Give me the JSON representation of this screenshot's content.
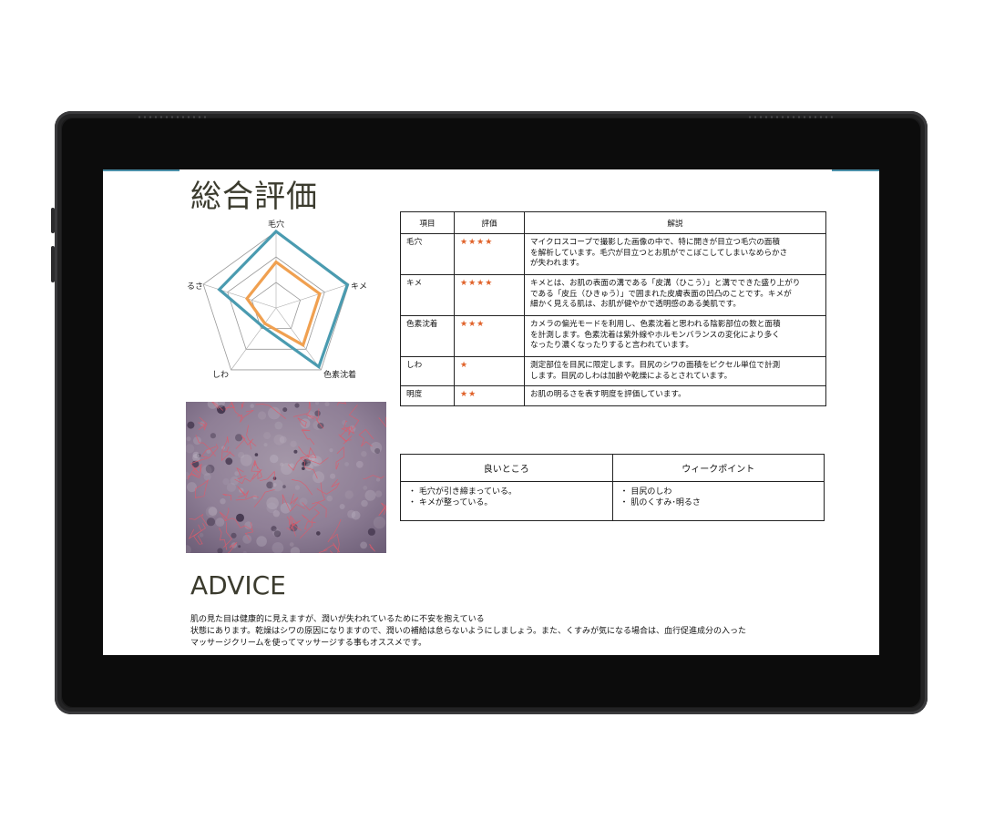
{
  "report": {
    "title": "総合評価",
    "radar": {
      "labels": [
        "毛穴",
        "キメ",
        "色素沈着",
        "しわ",
        "るさ"
      ],
      "levels": 3,
      "series": [
        {
          "color": "#4a9bb0",
          "values": [
            1.0,
            0.98,
            0.95,
            0.3,
            0.78
          ]
        },
        {
          "color": "#f0a050",
          "values": [
            0.6,
            0.6,
            0.6,
            0.25,
            0.4
          ]
        }
      ]
    },
    "eval_table": {
      "headers": [
        "項目",
        "評価",
        "解説"
      ],
      "rows": [
        {
          "item": "毛穴",
          "stars": "★★★★",
          "lines": [
            "マイクロスコープで撮影した画像の中で、特に開きが目立つ毛穴の面積",
            "を解析しています。毛穴が目立つとお肌がでこぼこしてしまいなめらかさ",
            "が失われます。"
          ]
        },
        {
          "item": "キメ",
          "stars": "★★★★",
          "lines": [
            "キメとは、お肌の表面の溝である「皮溝（ひこう）」と溝でできた盛り上がり",
            "である「皮丘（ひきゅう）」で囲まれた皮膚表面の凹凸のことです。キメが",
            "細かく見える肌は、お肌が健やかで透明感のある美肌です。"
          ]
        },
        {
          "item": "色素沈着",
          "stars": "★★★",
          "lines": [
            "カメラの偏光モードを利用し、色素沈着と思われる陰影部位の数と面積",
            "を計測します。色素沈着は紫外線やホルモンバランスの変化により多く",
            "なったり濃くなったりすると言われています。"
          ]
        },
        {
          "item": "しわ",
          "stars": "★",
          "lines": [
            "測定部位を目尻に限定します。目尻のシワの面積をピクセル単位で計測",
            "します。目尻のしわは加齢や乾燥によるとされています。"
          ]
        },
        {
          "item": "明度",
          "stars": "★★",
          "lines": [
            "お肌の明るさを表す明度を評価しています。"
          ]
        }
      ]
    },
    "good_points": {
      "header": "良いところ",
      "items": [
        "・ 毛穴が引き締まっている。",
        "・ キメが整っている。"
      ]
    },
    "weak_points": {
      "header": "ウィークポイント",
      "items": [
        "・ 目尻のしわ",
        "・ 肌のくすみ･明るさ"
      ]
    },
    "advice": {
      "title": "ADVICE",
      "lines": [
        "肌の見た目は健康的に見えますが、潤いが失われているために不安を抱えている",
        "状態にあります。乾燥はシワの原因になりますので、潤いの補給は怠らないようにしましょう。また、くすみが気になる場合は、血行促進成分の入った",
        "マッサージクリームを使ってマッサージする事もオススメです。"
      ]
    }
  },
  "colors": {
    "accent": "#4a9bb0",
    "stars": "#e0622a",
    "bezel": "#1b1b1c"
  }
}
